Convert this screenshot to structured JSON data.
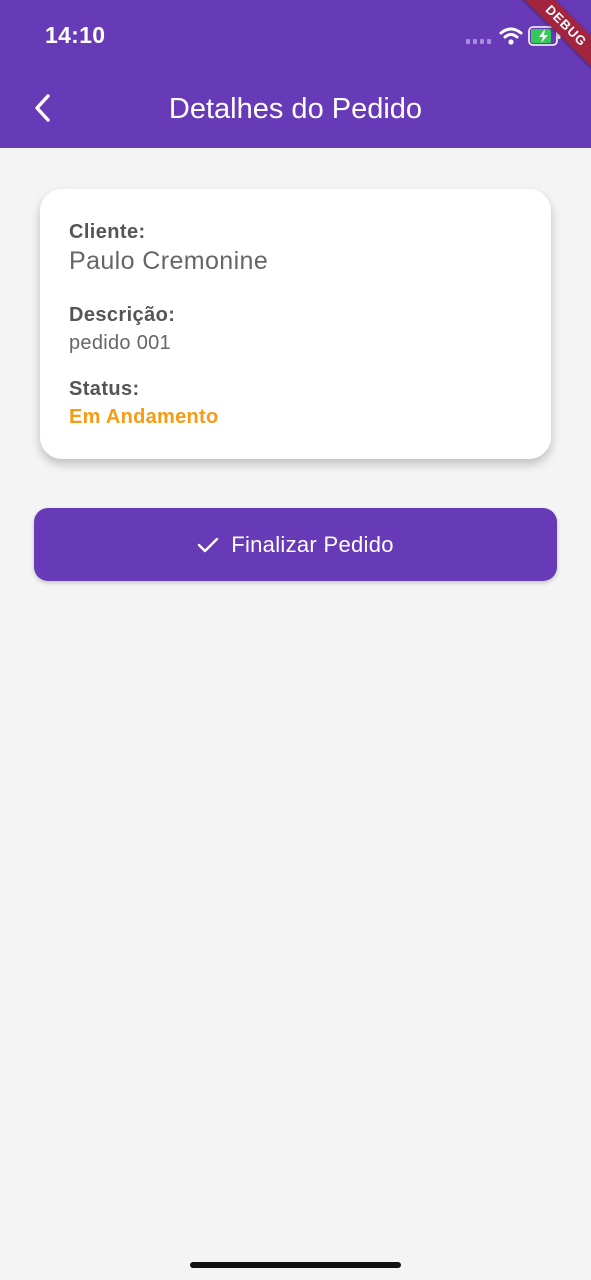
{
  "status_bar": {
    "time": "14:10"
  },
  "header": {
    "title": "Detalhes do Pedido",
    "back_icon": "chevron-left-icon"
  },
  "debug_banner": "DEBUG",
  "order": {
    "client_label": "Cliente:",
    "client_value": "Paulo Cremonine",
    "description_label": "Descrição:",
    "description_value": "pedido 001",
    "status_label": "Status:",
    "status_value": "Em Andamento"
  },
  "actions": {
    "finish_label": "Finalizar Pedido",
    "finish_icon": "check-icon"
  },
  "colors": {
    "primary": "#673ab7",
    "status_in_progress": "#f79a14",
    "background": "#f4f4f4"
  }
}
